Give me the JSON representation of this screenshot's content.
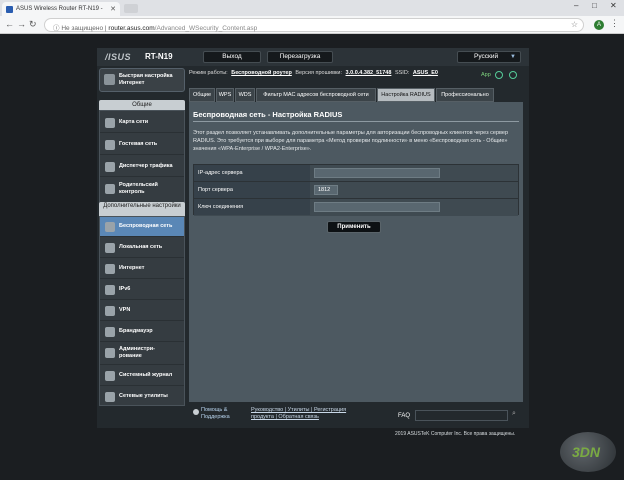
{
  "browser": {
    "tab_title": "ASUS Wireless Router RT-N19 - ",
    "address_warning": "Не защищено",
    "address_host": "router.asus.com",
    "address_path": "/Advanced_WSecurity_Content.asp",
    "profile_letter": "A"
  },
  "header": {
    "logo": "/ISUS",
    "model": "RT-N19",
    "logout_label": "Выход",
    "reboot_label": "Перезагрузка",
    "language": "Русский"
  },
  "status": {
    "mode_label": "Режим работы:",
    "mode_value": "Беспроводной роутер",
    "firmware_label": "Версия прошивки:",
    "firmware_value": "3.0.0.4.382_51748",
    "ssid_label": "SSID:",
    "ssid_value": "ASUS_E0",
    "app_label": "App"
  },
  "sidebar": {
    "quick_setup": "Быстрая настройка Интернет",
    "general_title": "Общие",
    "general_items": [
      {
        "label": "Карта сети"
      },
      {
        "label": "Гостевая сеть"
      },
      {
        "label": "Диспетчер трафика"
      },
      {
        "label": "Родительский контроль"
      }
    ],
    "advanced_title": "Дополнительные настройки",
    "advanced_items": [
      {
        "label": "Беспроводная сеть"
      },
      {
        "label": "Локальная сеть"
      },
      {
        "label": "Интернет"
      },
      {
        "label": "IPv6"
      },
      {
        "label": "VPN"
      },
      {
        "label": "Брандмауэр"
      },
      {
        "label": "Администри-рование"
      },
      {
        "label": "Системный журнал"
      },
      {
        "label": "Сетевые утилиты"
      }
    ]
  },
  "tabs": [
    {
      "label": "Общие"
    },
    {
      "label": "WPS"
    },
    {
      "label": "WDS"
    },
    {
      "label": "Фильтр MAC адресов беспроводной сети"
    },
    {
      "label": "Настройка RADIUS"
    },
    {
      "label": "Профессионально"
    }
  ],
  "main": {
    "title": "Беспроводная сеть - Настройка RADIUS",
    "description": "Этот раздел позволяет устанавливать дополнительные параметры для авторизации беспроводных клиентов через сервер RADIUS. Это требуется при выборе для параметра «Метод проверки подлинности» в меню «Беспроводная сеть - Общие» значения «WPA-Enterprise / WPA2-Enterprise».",
    "fields": [
      {
        "label": "IP-адрес сервера",
        "value": ""
      },
      {
        "label": "Порт сервера",
        "value": "1812"
      },
      {
        "label": "Ключ соединения",
        "value": ""
      }
    ],
    "apply_label": "Применить"
  },
  "footer": {
    "help_label": "Помощь & Поддержка",
    "links_line1": "Руководство | Утилиты | Регистрация",
    "links_line2": "продукта | Обратная связь",
    "faq_label": "FAQ",
    "copyright": "2019 ASUSTeK Computer Inc. Все права защищены."
  },
  "watermark": {
    "text": "3DN"
  }
}
